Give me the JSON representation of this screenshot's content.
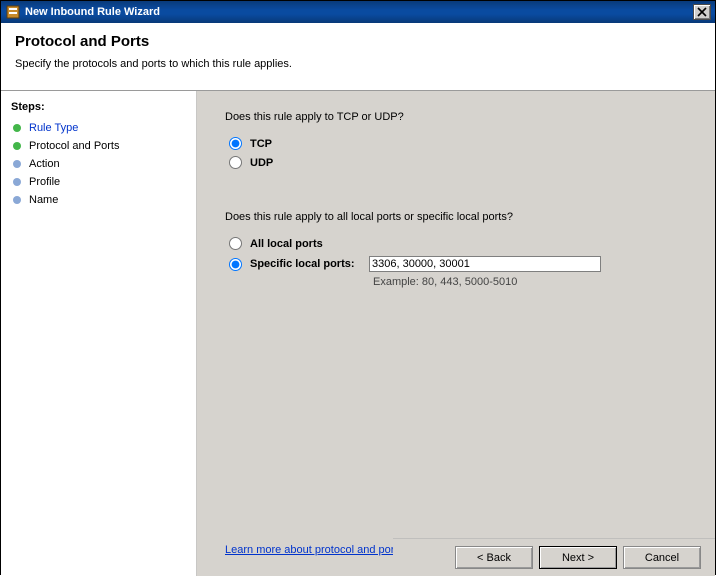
{
  "window": {
    "title": "New Inbound Rule Wizard"
  },
  "header": {
    "title": "Protocol and Ports",
    "subtitle": "Specify the protocols and ports to which this rule applies."
  },
  "steps": {
    "title": "Steps:",
    "items": [
      {
        "label": "Rule Type",
        "state": "completed"
      },
      {
        "label": "Protocol and Ports",
        "state": "current"
      },
      {
        "label": "Action",
        "state": "pending"
      },
      {
        "label": "Profile",
        "state": "pending"
      },
      {
        "label": "Name",
        "state": "pending"
      }
    ]
  },
  "content": {
    "protocol_question": "Does this rule apply to TCP or UDP?",
    "tcp_label": "TCP",
    "udp_label": "UDP",
    "protocol_selected": "tcp",
    "ports_question": "Does this rule apply to all local ports or specific local ports?",
    "all_ports_label": "All local ports",
    "specific_ports_label": "Specific local ports:",
    "ports_selected": "specific",
    "ports_value": "3306, 30000, 30001",
    "example_text": "Example: 80, 443, 5000-5010",
    "learn_more": "Learn more about protocol and ports"
  },
  "footer": {
    "back": "< Back",
    "next": "Next >",
    "cancel": "Cancel"
  }
}
